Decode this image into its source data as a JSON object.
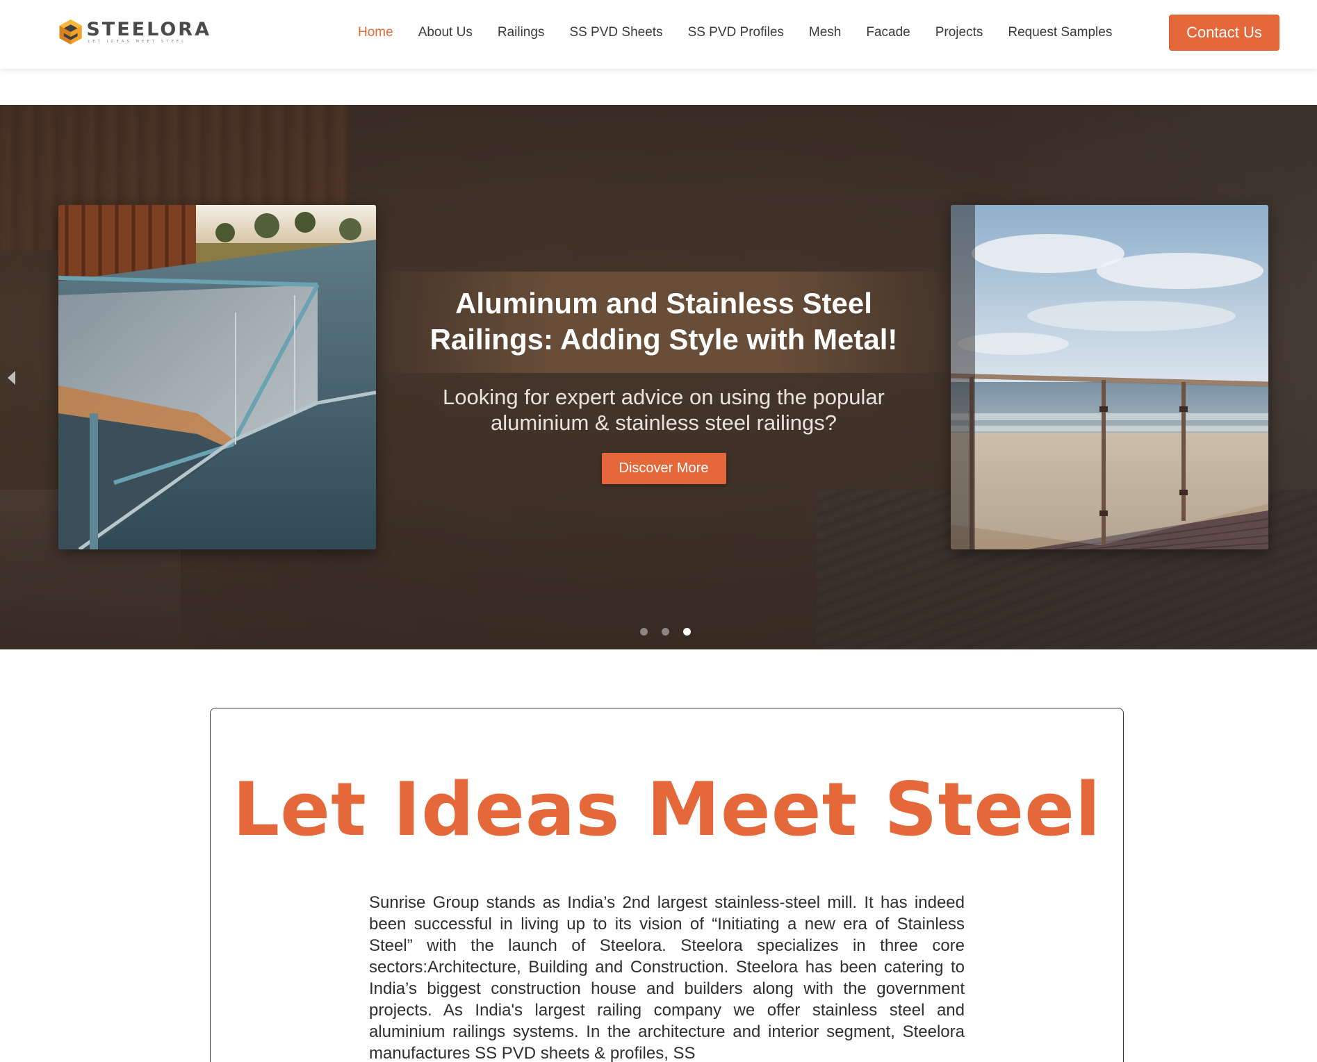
{
  "brand": {
    "name": "STEELORA",
    "tagline": "LET IDEAS MEET STEEL",
    "logo_icon": "steelora-hexagon-logo",
    "accent_color": "#e4683a"
  },
  "nav": {
    "items": [
      {
        "label": "Home",
        "active": true
      },
      {
        "label": "About Us",
        "active": false
      },
      {
        "label": "Railings",
        "active": false
      },
      {
        "label": "SS PVD Sheets",
        "active": false
      },
      {
        "label": "SS PVD Profiles",
        "active": false
      },
      {
        "label": "Mesh",
        "active": false
      },
      {
        "label": "Facade",
        "active": false
      },
      {
        "label": "Projects",
        "active": false
      },
      {
        "label": "Request Samples",
        "active": false
      }
    ],
    "contact_label": "Contact Us"
  },
  "hero": {
    "title": "Aluminum and Stainless Steel Railings: Adding Style with Metal!",
    "subtitle": "Looking for expert advice on using the popular aluminium & stainless steel railings?",
    "cta_label": "Discover More",
    "prev_icon": "triangle-left-icon",
    "slides_total": 3,
    "active_slide": 3
  },
  "intro": {
    "heading": "Let Ideas Meet Steel",
    "body": "Sunrise Group stands as India’s 2nd largest stainless-steel mill. It has indeed been successful in living up to its vision of “Initiating a new era of Stainless Steel” with the launch of Steelora. Steelora specializes in three core sectors:Architecture, Building and Construction. Steelora has been catering to India’s biggest construction house and builders along with the government projects. As India's largest railing company we offer stainless steel and aluminium railings systems. In the architecture and interior segment, Steelora manufactures SS PVD sheets & profiles, SS"
  }
}
